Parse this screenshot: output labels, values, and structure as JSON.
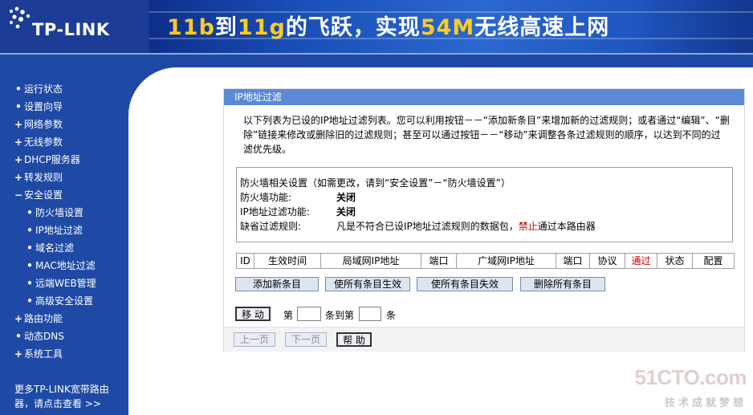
{
  "header": {
    "logo_text": "TP-LINK",
    "banner": {
      "part1": "11b",
      "part2": "到",
      "part3": "11g",
      "part4": "的飞跃，实现",
      "part5": "54M",
      "part6": "无线高速上网"
    }
  },
  "sidebar": {
    "items": [
      {
        "label": "运行状态",
        "bullet": "•"
      },
      {
        "label": "设置向导",
        "bullet": "•"
      },
      {
        "label": "网络参数",
        "bullet": "+"
      },
      {
        "label": "无线参数",
        "bullet": "+"
      },
      {
        "label": "DHCP服务器",
        "bullet": "+"
      },
      {
        "label": "转发规则",
        "bullet": "+"
      },
      {
        "label": "安全设置",
        "bullet": "−"
      },
      {
        "label": "防火墙设置",
        "bullet": "•"
      },
      {
        "label": "IP地址过滤",
        "bullet": "•"
      },
      {
        "label": "域名过滤",
        "bullet": "•"
      },
      {
        "label": "MAC地址过滤",
        "bullet": "•"
      },
      {
        "label": "远端WEB管理",
        "bullet": "•"
      },
      {
        "label": "高级安全设置",
        "bullet": "•"
      },
      {
        "label": "路由功能",
        "bullet": "+"
      },
      {
        "label": "动态DNS",
        "bullet": "•"
      },
      {
        "label": "系统工具",
        "bullet": "+"
      }
    ],
    "footer_line1": "更多TP-LINK宽带路由",
    "footer_line2": "器，请点击查看 >>"
  },
  "panel": {
    "title": "IP地址过滤",
    "intro": "以下列表为已设的IP地址过滤列表。您可以利用按钮－－“添加新条目”来增加新的过滤规则；或者通过“编辑”、“删除”链接来修改或删除旧的过滤规则；甚至可以通过按钮－－“移动”来调整各条过滤规则的顺序，以达到不同的过滤优先级。",
    "firewall": {
      "heading": "防火墙相关设置（如需更改，请到“安全设置”－“防火墙设置”）",
      "fw_label": "防火墙功能:",
      "fw_value": "关闭",
      "ipf_label": "IP地址过滤功能:",
      "ipf_value": "关闭",
      "default_label": "缺省过滤规则:",
      "default_pre": "凡是不符合已设IP地址过滤规则的数据包，",
      "default_red": "禁止",
      "default_post": "通过本路由器"
    },
    "table_headers": [
      "ID",
      "生效时间",
      "局域网IP地址",
      "端口",
      "广域网IP地址",
      "端口",
      "协议",
      "通过",
      "状态",
      "配置"
    ],
    "buttons": {
      "add": "添加新条目",
      "enable_all": "使所有条目生效",
      "disable_all": "使所有条目失效",
      "delete_all": "删除所有条目",
      "move": "移 动",
      "prev": "上一页",
      "next": "下一页",
      "help": "帮 助"
    },
    "move_row": {
      "label_pre": "第",
      "label_mid": "条到第",
      "label_post": "条",
      "from_value": "",
      "to_value": ""
    }
  },
  "watermark": {
    "top": "51CTO.com",
    "sub": "技术成就梦想"
  }
}
